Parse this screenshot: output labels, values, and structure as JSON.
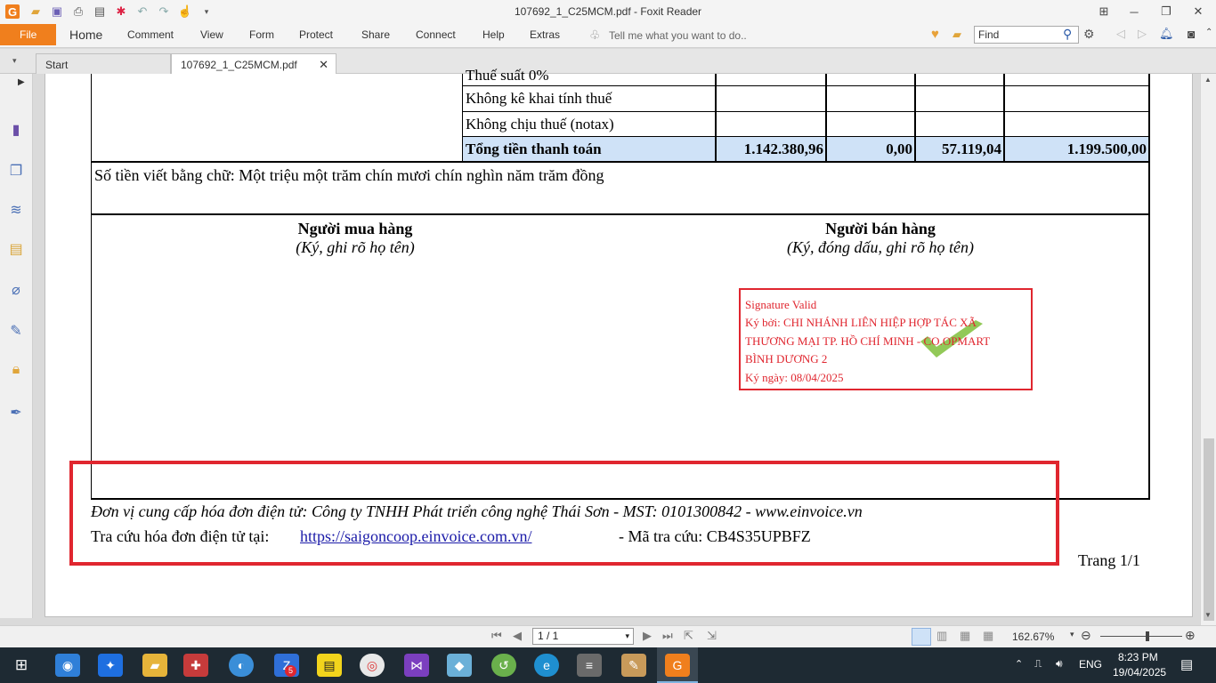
{
  "window": {
    "title": "107692_1_C25MCM.pdf - Foxit Reader"
  },
  "menu": {
    "file": "File",
    "items": [
      "Home",
      "Comment",
      "View",
      "Form",
      "Protect",
      "Share",
      "Connect",
      "Help",
      "Extras"
    ],
    "tell_me": "Tell me what you want to do..",
    "find_placeholder": "Find"
  },
  "tabs": {
    "start": "Start",
    "document": "107692_1_C25MCM.pdf"
  },
  "invoice": {
    "rows": [
      "Thuế suất 0%",
      "Không kê khai tính thuế",
      "Không chịu thuế (notax)"
    ],
    "total_label": "Tổng tiền thanh toán",
    "total_values": [
      "1.142.380,96",
      "0,00",
      "57.119,04",
      "1.199.500,00"
    ],
    "amount_words": "Số tiền viết bằng chữ: Một triệu một trăm chín mươi chín nghìn năm trăm đồng",
    "buyer_title": "Người mua hàng",
    "buyer_note": "(Ký, ghi rõ họ tên)",
    "seller_title": "Người bán hàng",
    "seller_note": "(Ký, đóng dấu, ghi rõ họ tên)",
    "signature": {
      "status": "Signature Valid",
      "line1": "Ký bởi: CHI NHÁNH LIÊN HIỆP HỢP TÁC XÃ",
      "line2": "THƯƠNG MẠI TP. HỒ CHÍ MINH - CO.OPMART",
      "line3": "BÌNH DƯƠNG 2",
      "date": "Ký ngày: 08/04/2025"
    },
    "provider": "Đơn vị cung cấp hóa đơn điện tử: Công ty TNHH Phát triển công nghệ Thái Sơn - MST: 0101300842 - www.einvoice.vn",
    "lookup_label": "Tra cứu hóa đơn điện tử tại:",
    "lookup_url": "https://saigoncoop.einvoice.com.vn/",
    "lookup_code": "- Mã tra cứu: CB4S35UPBFZ",
    "page_footer": "Trang 1/1"
  },
  "status": {
    "page": "1 / 1",
    "zoom": "162.67%"
  },
  "taskbar": {
    "lang": "ENG",
    "time": "8:23 PM",
    "date": "19/04/2025",
    "zalo_badge": "5"
  },
  "colors": {
    "file_tab": "#f07f1d",
    "highlight": "#e0262f",
    "signature": "#e0262f",
    "total_row": "#cfe2f7"
  }
}
